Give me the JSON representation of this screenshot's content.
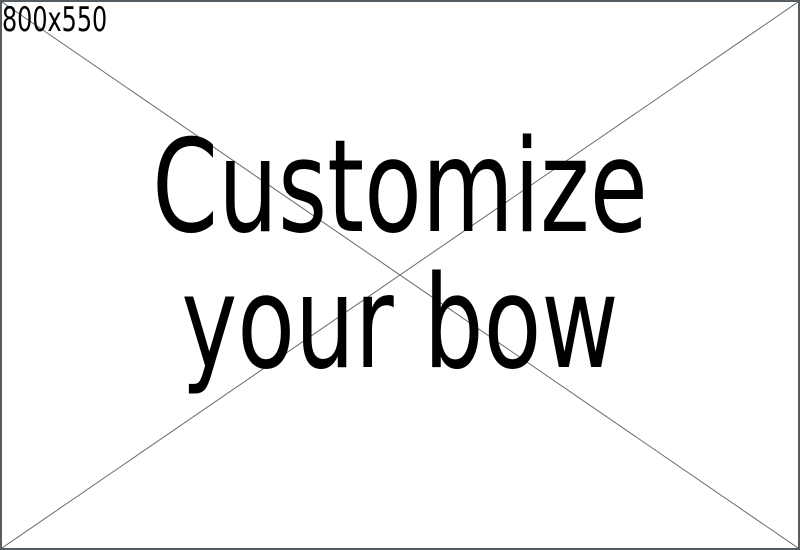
{
  "placeholder": {
    "size_label": "800x550",
    "headline": {
      "line1": "Customize",
      "line2": "your bow"
    },
    "colors": {
      "background": "#ffffff",
      "border": "#555d63",
      "cross_lines": "#6b6b6b",
      "text": "#000000"
    }
  }
}
